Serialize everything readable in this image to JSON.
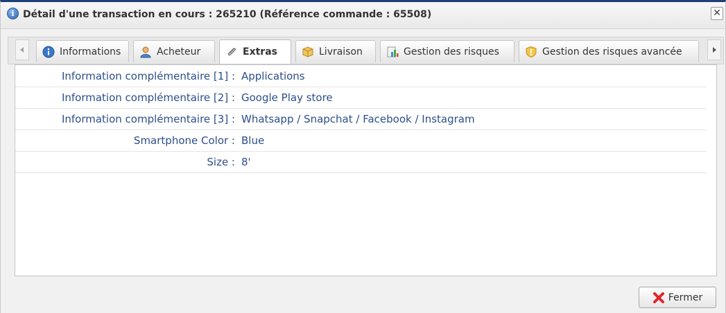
{
  "dialog": {
    "title": "Détail d'une transaction en cours : 265210 (Référence commande : 65508)",
    "close_glyph": "✕",
    "title_icon_glyph": "i"
  },
  "tabs": [
    {
      "label": "Informations",
      "icon": "info-icon",
      "active": false
    },
    {
      "label": "Acheteur",
      "icon": "user-icon",
      "active": false
    },
    {
      "label": "Extras",
      "icon": "paperclip-icon",
      "active": true
    },
    {
      "label": "Livraison",
      "icon": "package-icon",
      "active": false
    },
    {
      "label": "Gestion des risques",
      "icon": "risk-report-icon",
      "active": false
    },
    {
      "label": "Gestion des risques avancée",
      "icon": "shield-icon",
      "active": false
    }
  ],
  "tab_scroll": {
    "left_glyph": "◀",
    "right_glyph": "▶"
  },
  "extras": [
    {
      "label": "Information complémentaire [1] :",
      "value": "Applications"
    },
    {
      "label": "Information complémentaire [2] :",
      "value": "Google Play store"
    },
    {
      "label": "Information complémentaire [3] :",
      "value": "Whatsapp / Snapchat / Facebook / Instagram"
    },
    {
      "label": "Smartphone Color :",
      "value": "Blue"
    },
    {
      "label": "Size :",
      "value": "8'"
    }
  ],
  "footer": {
    "close_label": "Fermer",
    "close_icon": "red-x-icon"
  },
  "colors": {
    "text_blue": "#2c4f8a",
    "title_border": "#1f3f77",
    "close_red": "#e0262b"
  }
}
